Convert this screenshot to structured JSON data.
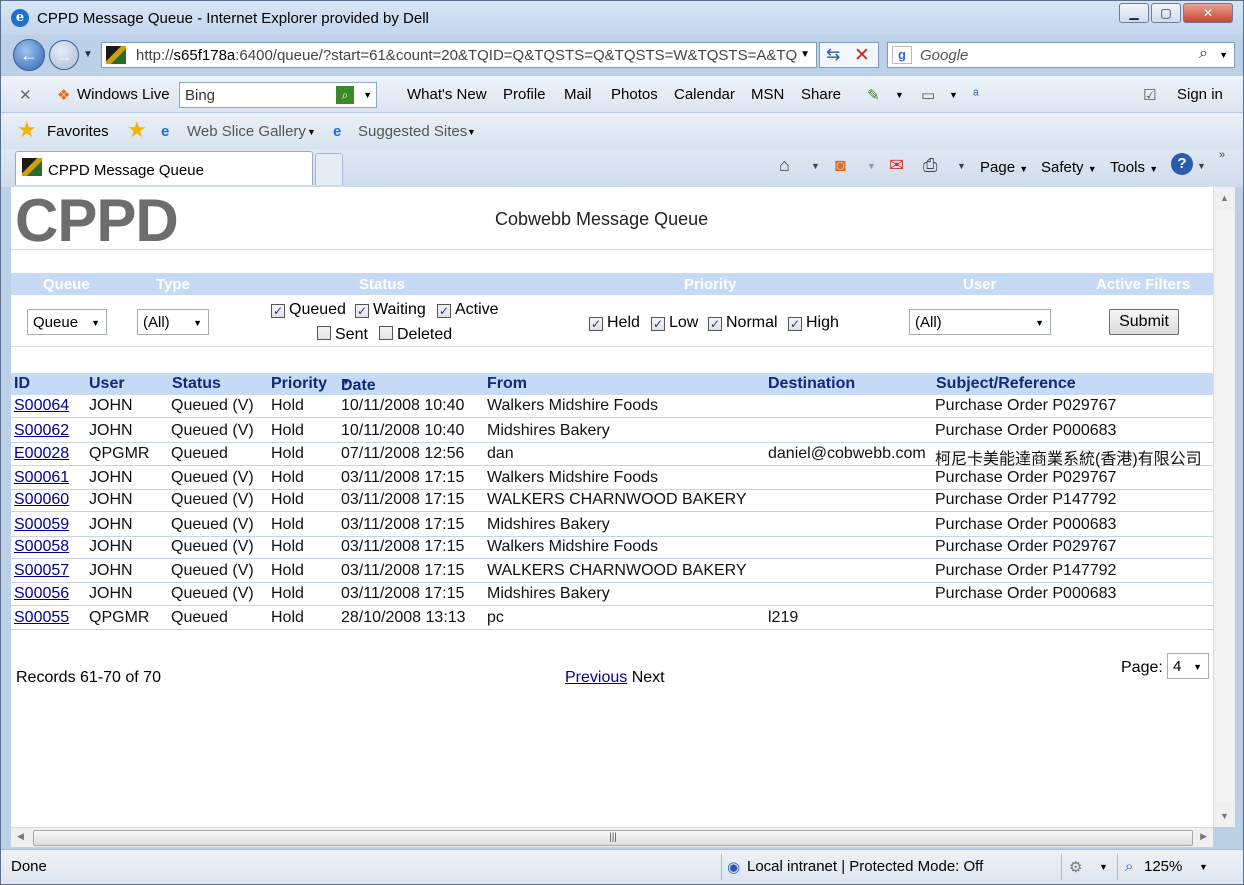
{
  "window": {
    "title": "CPPD Message Queue - Internet Explorer provided by Dell"
  },
  "address": {
    "url_prefix": "http://",
    "url_host": "s65f178a",
    "url_rest": ":6400/queue/?start=61&count=20&TQID=Q&TQSTS=Q&TQSTS=W&TQSTS=A&TQ"
  },
  "search": {
    "placeholder": "Google"
  },
  "links": {
    "windows_live": "Windows Live",
    "bing": "Bing",
    "items": [
      "What's New",
      "Profile",
      "Mail",
      "Photos",
      "Calendar",
      "MSN",
      "Share"
    ],
    "sign_in": "Sign in"
  },
  "favorites": {
    "label": "Favorites",
    "web_slice": "Web Slice Gallery",
    "suggested": "Suggested Sites"
  },
  "tab": {
    "title": "CPPD Message Queue"
  },
  "commands": {
    "page": "Page",
    "safety": "Safety",
    "tools": "Tools"
  },
  "page": {
    "logo": "CPPD",
    "title": "Cobwebb Message Queue",
    "filters": {
      "headers": {
        "queue": "Queue",
        "type": "Type",
        "status": "Status",
        "priority": "Priority",
        "user": "User",
        "active": "Active Filters"
      },
      "queue_value": "Queue",
      "type_value": "(All)",
      "user_value": "(All)",
      "status": {
        "queued": "Queued",
        "waiting": "Waiting",
        "active": "Active",
        "sent": "Sent",
        "deleted": "Deleted"
      },
      "priority": {
        "held": "Held",
        "low": "Low",
        "normal": "Normal",
        "high": "High"
      },
      "submit": "Submit"
    },
    "table": {
      "headers": {
        "id": "ID",
        "user": "User",
        "status": "Status",
        "priority": "Priority",
        "date": "Date",
        "from": "From",
        "destination": "Destination",
        "subject": "Subject/Reference"
      },
      "rows": [
        {
          "id": "S00064",
          "user": "JOHN",
          "status": "Queued (V)",
          "priority": "Hold",
          "date": "10/11/2008 10:40",
          "from": "Walkers Midshire Foods",
          "destination": "",
          "subject": "Purchase Order P029767"
        },
        {
          "id": "S00062",
          "user": "JOHN",
          "status": "Queued (V)",
          "priority": "Hold",
          "date": "10/11/2008 10:40",
          "from": "Midshires Bakery",
          "destination": "",
          "subject": "Purchase Order P000683"
        },
        {
          "id": "E00028",
          "user": "QPGMR",
          "status": "Queued",
          "priority": "Hold",
          "date": "07/11/2008 12:56",
          "from": "dan",
          "destination": "daniel@cobwebb.com",
          "subject": "柯尼卡美能達商業系統(香港)有限公司"
        },
        {
          "id": "S00061",
          "user": "JOHN",
          "status": "Queued (V)",
          "priority": "Hold",
          "date": "03/11/2008 17:15",
          "from": "Walkers Midshire Foods",
          "destination": "",
          "subject": "Purchase Order P029767"
        },
        {
          "id": "S00060",
          "user": "JOHN",
          "status": "Queued (V)",
          "priority": "Hold",
          "date": "03/11/2008 17:15",
          "from": "WALKERS CHARNWOOD BAKERY",
          "destination": "",
          "subject": "Purchase Order P147792"
        },
        {
          "id": "S00059",
          "user": "JOHN",
          "status": "Queued (V)",
          "priority": "Hold",
          "date": "03/11/2008 17:15",
          "from": "Midshires Bakery",
          "destination": "",
          "subject": "Purchase Order P000683"
        },
        {
          "id": "S00058",
          "user": "JOHN",
          "status": "Queued (V)",
          "priority": "Hold",
          "date": "03/11/2008 17:15",
          "from": "Walkers Midshire Foods",
          "destination": "",
          "subject": "Purchase Order P029767"
        },
        {
          "id": "S00057",
          "user": "JOHN",
          "status": "Queued (V)",
          "priority": "Hold",
          "date": "03/11/2008 17:15",
          "from": "WALKERS CHARNWOOD BAKERY",
          "destination": "",
          "subject": "Purchase Order P147792"
        },
        {
          "id": "S00056",
          "user": "JOHN",
          "status": "Queued (V)",
          "priority": "Hold",
          "date": "03/11/2008 17:15",
          "from": "Midshires Bakery",
          "destination": "",
          "subject": "Purchase Order P000683"
        },
        {
          "id": "S00055",
          "user": "QPGMR",
          "status": "Queued",
          "priority": "Hold",
          "date": "28/10/2008 13:13",
          "from": "pc",
          "destination": "l219",
          "subject": ""
        }
      ]
    },
    "footer": {
      "records": "Records 61-70 of 70",
      "previous": "Previous",
      "next": "Next",
      "page_label": "Page:",
      "page_value": "4"
    }
  },
  "status": {
    "left": "Done",
    "zone": "Local intranet | Protected Mode: Off",
    "zoom": "125%"
  }
}
